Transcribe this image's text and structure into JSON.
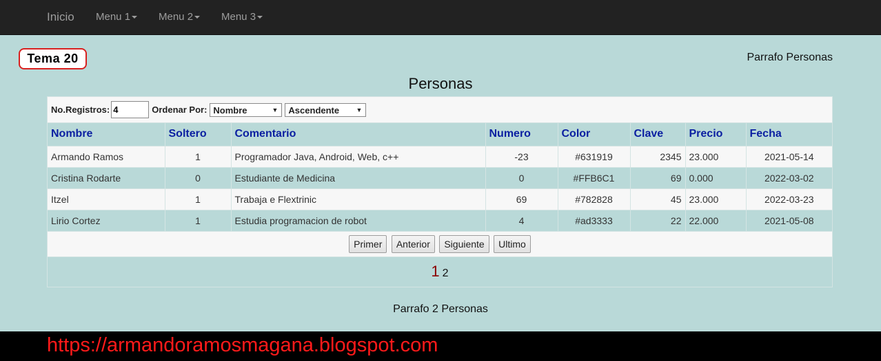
{
  "nav": {
    "brand": "Inicio",
    "menus": [
      "Menu 1",
      "Menu 2",
      "Menu 3"
    ]
  },
  "tema": "Tema 20",
  "parrafo": "Parrafo Personas",
  "title": "Personas",
  "controls": {
    "registros_label": "No.Registros:",
    "registros_value": "4",
    "ordenar_label": "Ordenar Por:",
    "ordenar_value": "Nombre",
    "orden_value": "Ascendente"
  },
  "table": {
    "headers": [
      "Nombre",
      "Soltero",
      "Comentario",
      "Numero",
      "Color",
      "Clave",
      "Precio",
      "Fecha"
    ],
    "rows": [
      [
        "Armando Ramos",
        "1",
        "Programador Java, Android, Web, c++",
        "-23",
        "#631919",
        "2345",
        "23.000",
        "2021-05-14"
      ],
      [
        "Cristina Rodarte",
        "0",
        "Estudiante de Medicina",
        "0",
        "#FFB6C1",
        "69",
        "0.000",
        "2022-03-02"
      ],
      [
        "Itzel",
        "1",
        "Trabaja e Flextrinic",
        "69",
        "#782828",
        "45",
        "23.000",
        "2022-03-23"
      ],
      [
        "Lirio Cortez",
        "1",
        "Estudia programacion de robot",
        "4",
        "#ad3333",
        "22",
        "22.000",
        "2021-05-08"
      ]
    ]
  },
  "buttons": [
    "Primer",
    "Anterior",
    "Siguiente",
    "Ultimo"
  ],
  "pager": {
    "current": "1",
    "next": "2"
  },
  "parrafo2": "Parrafo 2 Personas",
  "footer_url": "https://armandoramosmagana.blogspot.com"
}
